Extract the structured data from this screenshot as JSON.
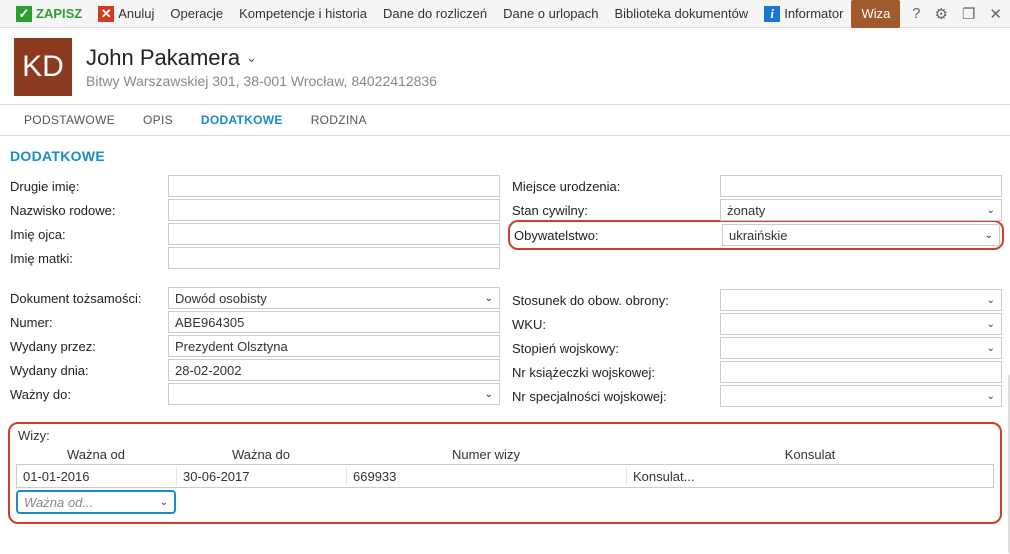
{
  "toolbar": {
    "save": "ZAPISZ",
    "cancel": "Anuluj",
    "operations": "Operacje",
    "competencies": "Kompetencje i historia",
    "billing": "Dane do rozliczeń",
    "leave": "Dane o urlopach",
    "docs": "Biblioteka dokumentów",
    "info": "Informator",
    "visa": "Wiza"
  },
  "header": {
    "initials": "KD",
    "name": "John Pakamera",
    "address": "Bitwy Warszawskiej 301, 38-001 Wrocław, 84022412836"
  },
  "tabs": {
    "t1": "PODSTAWOWE",
    "t2": "OPIS",
    "t3": "DODATKOWE",
    "t4": "RODZINA"
  },
  "section": "DODATKOWE",
  "labels": {
    "middle": "Drugie imię:",
    "maiden": "Nazwisko rodowe:",
    "father": "Imię ojca:",
    "mother": "Imię matki:",
    "id_doc": "Dokument tożsamości:",
    "number": "Numer:",
    "issued_by": "Wydany przez:",
    "issued_on": "Wydany dnia:",
    "valid_to": "Ważny do:",
    "birthplace": "Miejsce urodzenia:",
    "marital": "Stan cywilny:",
    "citizenship": "Obywatelstwo:",
    "defense": "Stosunek do obow. obrony:",
    "wku": "WKU:",
    "rank": "Stopień wojskowy:",
    "book": "Nr książeczki wojskowej:",
    "spec": "Nr specjalności wojskowej:"
  },
  "values": {
    "id_doc": "Dowód osobisty",
    "number": "ABE964305",
    "issued_by": "Prezydent Olsztyna",
    "issued_on": "28-02-2002",
    "marital": "żonaty",
    "citizenship": "ukraińskie"
  },
  "visa": {
    "title": "Wizy:",
    "headers": {
      "from": "Ważna od",
      "to": "Ważna do",
      "num": "Numer wizy",
      "cons": "Konsulat"
    },
    "rows": [
      {
        "from": "01-01-2016",
        "to": "30-06-2017",
        "num": "669933",
        "cons": "Konsulat..."
      }
    ],
    "filter_placeholder": "Ważna od..."
  }
}
